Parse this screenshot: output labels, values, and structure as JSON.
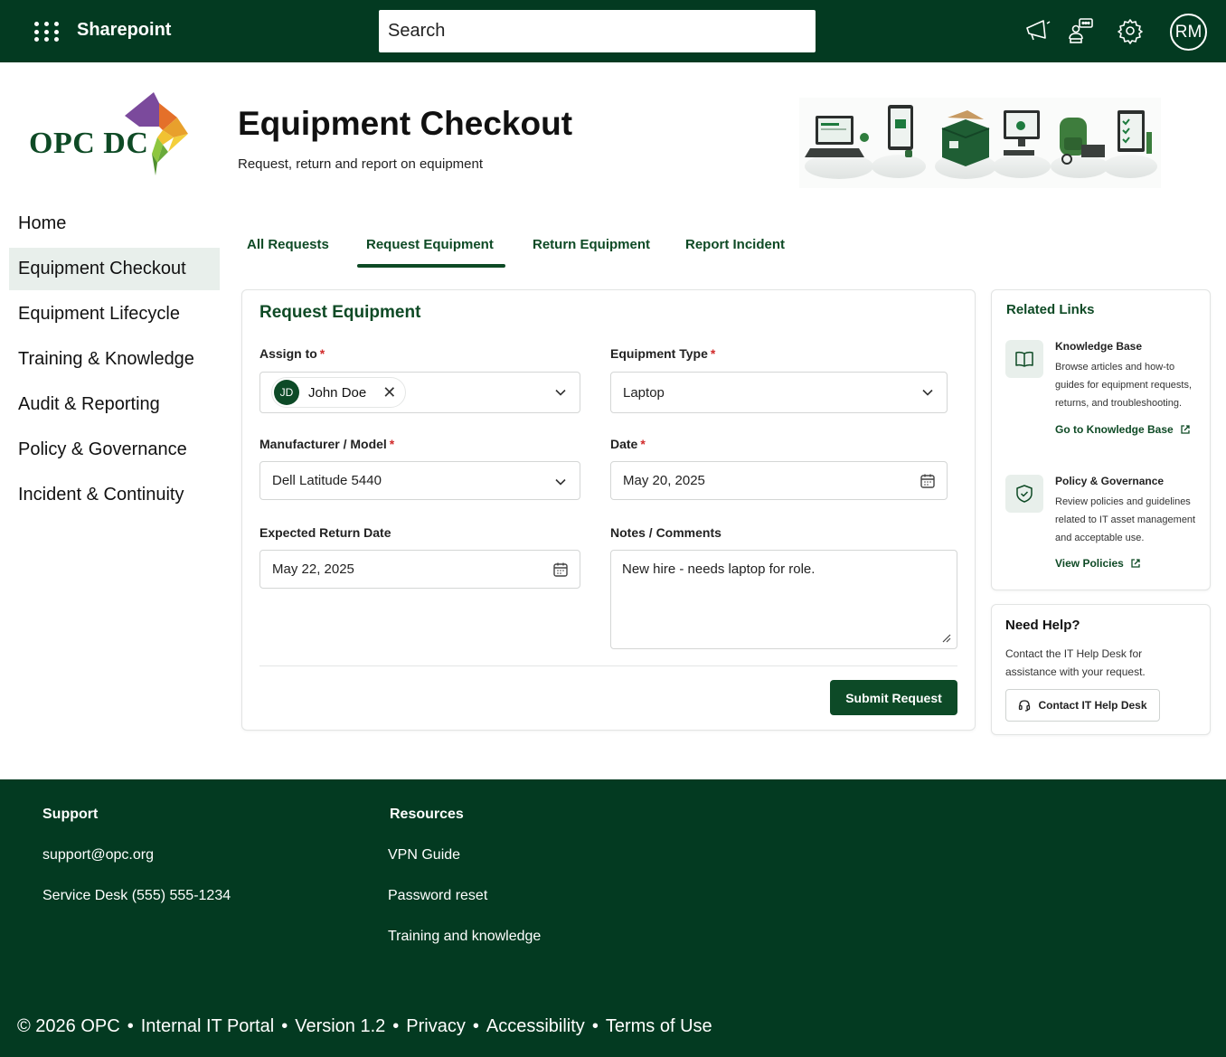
{
  "topbar": {
    "app_name": "Sharepoint",
    "search_placeholder": "Search",
    "user_initials": "RM",
    "icons": [
      "waffle-icon",
      "megaphone-icon",
      "chat-org-icon",
      "gear-icon"
    ]
  },
  "header": {
    "logo_text": "OPC DC",
    "title": "Equipment Checkout",
    "subtitle": "Request, return and report on equipment"
  },
  "sidebar": {
    "items": [
      {
        "label": "Home",
        "active": false
      },
      {
        "label": "Equipment Checkout",
        "active": true
      },
      {
        "label": "Equipment Lifecycle",
        "active": false
      },
      {
        "label": "Training & Knowledge",
        "active": false
      },
      {
        "label": "Audit & Reporting",
        "active": false
      },
      {
        "label": "Policy & Governance",
        "active": false
      },
      {
        "label": "Incident & Continuity",
        "active": false
      }
    ]
  },
  "tabs": [
    {
      "label": "All Requests",
      "active": false
    },
    {
      "label": "Request Equipment",
      "active": true
    },
    {
      "label": "Return Equipment",
      "active": false
    },
    {
      "label": "Report Incident",
      "active": false
    }
  ],
  "form": {
    "title": "Request Equipment",
    "assign_to": {
      "label": "Assign to",
      "required_mark": "*",
      "initials": "JD",
      "name": "John Doe",
      "remove_glyph": "✕"
    },
    "equipment_type": {
      "label": "Equipment Type",
      "required_mark": "*",
      "value": "Laptop"
    },
    "manufacturer": {
      "label": "Manufacturer / Model",
      "required_mark": "*",
      "value": "Dell Latitude 5440"
    },
    "date": {
      "label": "Date",
      "required_mark": "*",
      "value": "May 20, 2025"
    },
    "expected_return": {
      "label": "Expected Return Date",
      "value": "May 22, 2025"
    },
    "notes": {
      "label": "Notes / Comments",
      "value": "New hire - needs laptop for role."
    },
    "submit_label": "Submit Request"
  },
  "related_links": {
    "title": "Related Links",
    "items": [
      {
        "title": "Knowledge Base",
        "description": "Browse articles and how-to guides for equipment requests, returns, and troubleshooting.",
        "link": "Go to Knowledge Base",
        "icon": "book-icon"
      },
      {
        "title": "Policy & Governance",
        "description": "Review policies and guidelines related to IT asset management and acceptable use.",
        "link": "View Policies",
        "icon": "shield-check-icon"
      }
    ]
  },
  "help": {
    "title": "Need Help?",
    "description": "Contact the IT Help Desk for assistance with your request.",
    "button": "Contact IT Help Desk"
  },
  "footer": {
    "support": {
      "heading": "Support",
      "items": [
        "support@opc.org",
        "Service Desk (555) 555-1234"
      ]
    },
    "resources": {
      "heading": "Resources",
      "items": [
        "VPN Guide",
        "Password reset",
        "Training and knowledge"
      ]
    },
    "bottom": {
      "copyright": "© 2026 OPC",
      "portal": "Internal IT Portal",
      "version": "Version 1.2",
      "links": [
        "Privacy",
        "Accessibility",
        "Terms of Use"
      ],
      "separator": "•"
    }
  },
  "colors": {
    "brand_dark_green": "#033a21",
    "accent_green": "#0e4a25",
    "active_nav_bg": "#e8efeb",
    "required_red": "#d12b2b"
  }
}
